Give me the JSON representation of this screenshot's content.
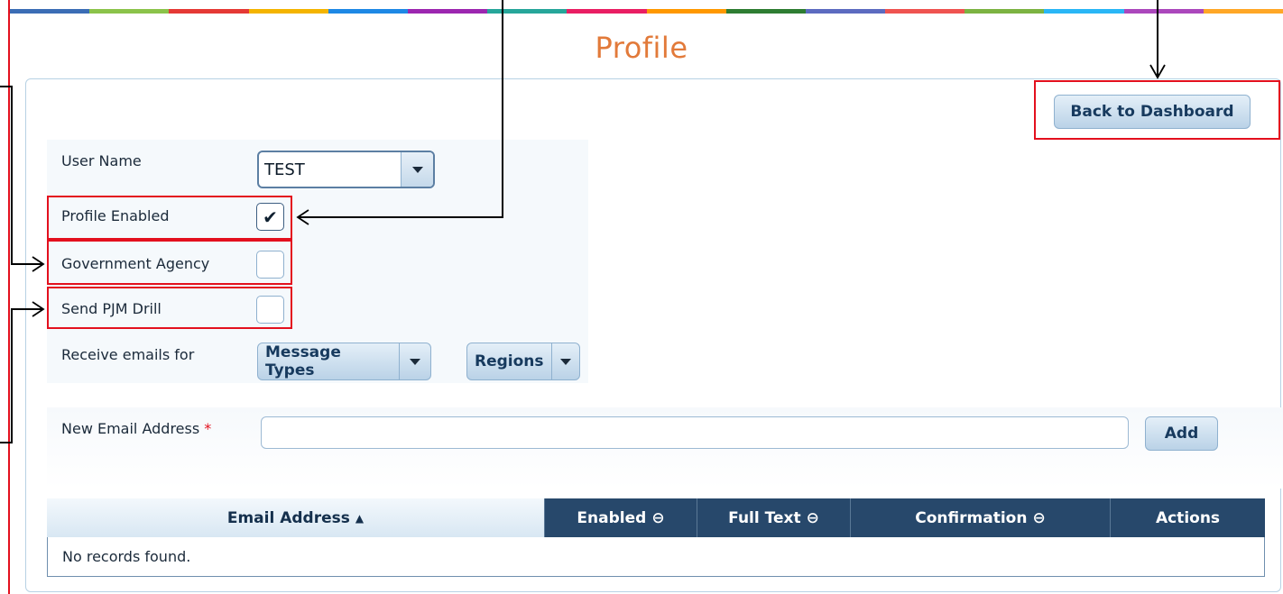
{
  "page": {
    "title": "Profile"
  },
  "toolbar": {
    "back_label": "Back to Dashboard"
  },
  "form": {
    "user_name": {
      "label": "User Name",
      "value": "TEST"
    },
    "profile_enabled": {
      "label": "Profile Enabled",
      "checked": true,
      "mark": "✔"
    },
    "government_agency": {
      "label": "Government Agency",
      "checked": false
    },
    "send_pjm_drill": {
      "label": "Send PJM Drill",
      "checked": false
    },
    "receive_emails": {
      "label": "Receive emails for",
      "message_types": "Message Types",
      "regions": "Regions"
    }
  },
  "email": {
    "label": "New Email Address",
    "required_mark": "*",
    "value": "",
    "add_label": "Add"
  },
  "table": {
    "columns": [
      {
        "label": "Email Address",
        "glyph": "▲"
      },
      {
        "label": "Enabled",
        "glyph": "⊖"
      },
      {
        "label": "Full Text",
        "glyph": "⊖"
      },
      {
        "label": "Confirmation",
        "glyph": "⊖"
      },
      {
        "label": "Actions",
        "glyph": ""
      }
    ],
    "empty_text": "No records found."
  },
  "colors": {
    "title": "#e27a3a",
    "header": "#27486b",
    "highlight": "#e3101e",
    "stripe": [
      "#3b6db5",
      "#8bc34a",
      "#e53935",
      "#f4b400",
      "#1e88e5",
      "#9c27b0",
      "#26a69a",
      "#e91e63",
      "#ff9800",
      "#2e7d32",
      "#5c6bc0",
      "#ef5350",
      "#7cb342",
      "#29b6f6",
      "#ab47bc",
      "#ffa726"
    ]
  }
}
